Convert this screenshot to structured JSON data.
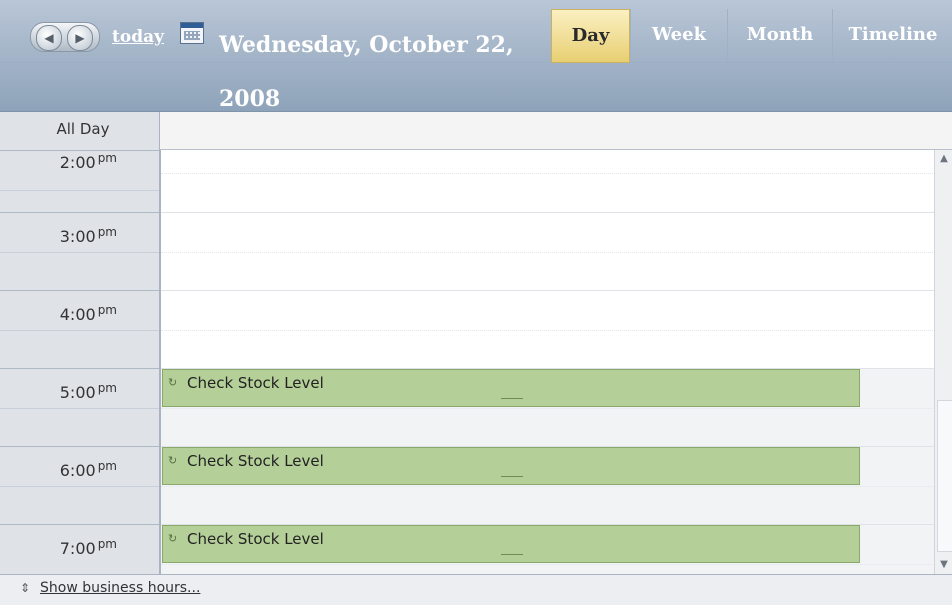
{
  "header": {
    "today_label": "today",
    "date_title": "Wednesday, October 22, 2008",
    "nav_prev_icon": "◀",
    "nav_next_icon": "▶",
    "tabs": [
      {
        "label": "Day",
        "active": true
      },
      {
        "label": "Week",
        "active": false
      },
      {
        "label": "Month",
        "active": false
      },
      {
        "label": "Timeline",
        "active": false
      }
    ]
  },
  "time_column": {
    "all_day_label": "All Day",
    "hours": [
      {
        "time": "2:00",
        "ampm": "pm"
      },
      {
        "time": "3:00",
        "ampm": "pm"
      },
      {
        "time": "4:00",
        "ampm": "pm"
      },
      {
        "time": "5:00",
        "ampm": "pm"
      },
      {
        "time": "6:00",
        "ampm": "pm"
      },
      {
        "time": "7:00",
        "ampm": "pm"
      }
    ]
  },
  "events": [
    {
      "title": "Check Stock Level",
      "time": "5:00 pm",
      "recurring_icon": "↻"
    },
    {
      "title": "Check Stock Level",
      "time": "6:00 pm",
      "recurring_icon": "↻"
    },
    {
      "title": "Check Stock Level",
      "time": "7:00 pm",
      "recurring_icon": "↻"
    }
  ],
  "footer": {
    "toggle_icon": "⇕",
    "link_label": "Show business hours..."
  },
  "colors": {
    "header_top": "#b9c6d6",
    "active_tab": "#e8cf73",
    "event_fill": "#b5cf99",
    "event_border": "#8aa86c"
  }
}
